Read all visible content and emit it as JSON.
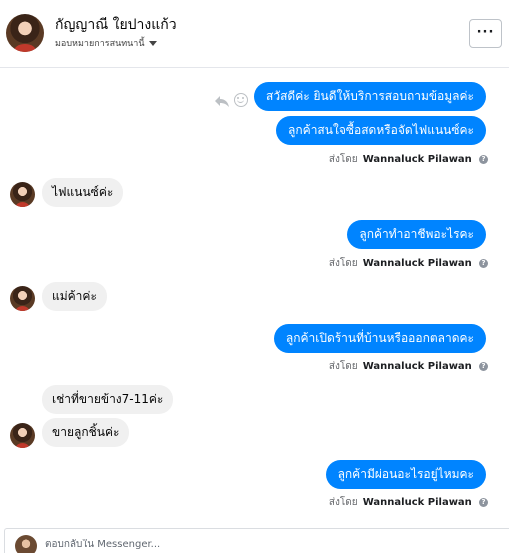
{
  "header": {
    "name": "กัญญาณี ใยปางแก้ว",
    "subtitle": "มอบหมายการสนทนานี้",
    "more_label": "···"
  },
  "messages": [
    {
      "direction": "out",
      "text": "สวัสดีค่ะ  ยินดีให้บริการสอบถามข้อมูลค่ะ"
    },
    {
      "direction": "out",
      "text": "ลูกค้าสนใจซื้อสดหรือจัดไฟแนนซ์คะ"
    },
    {
      "direction": "in",
      "text": "ไฟแนนซ์ค่ะ"
    },
    {
      "direction": "out",
      "text": "ลูกค้าทำอาชีพอะไรคะ"
    },
    {
      "direction": "in",
      "text": "แม่ค้าค่ะ"
    },
    {
      "direction": "out",
      "text": "ลูกค้าเปิดร้านที่บ้านหรือออกตลาดคะ"
    },
    {
      "direction": "in",
      "text": "เช่าที่ขายข้าง7-11ค่ะ"
    },
    {
      "direction": "in",
      "text": "ขายลูกชิ้นค่ะ"
    },
    {
      "direction": "out",
      "text": "ลูกค้ามีผ่อนอะไรอยู่ไหมคะ"
    }
  ],
  "sent_by": {
    "prefix": "ส่งโดย",
    "name": "Wannaluck Pilawan",
    "help": "?"
  },
  "composer": {
    "placeholder": "ตอบกลับใน Messenger..."
  },
  "colors": {
    "outgoing_bubble": "#0084ff",
    "incoming_bubble": "#f0f0f0"
  }
}
